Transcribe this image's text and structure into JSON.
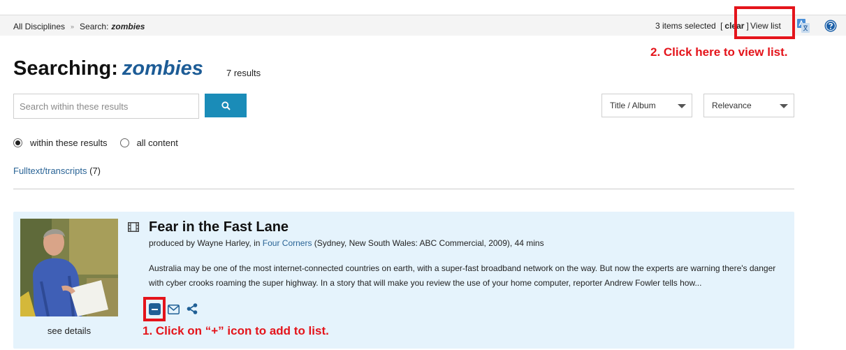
{
  "breadcrumb": {
    "root": "All Disciplines",
    "separator": "»",
    "search_prefix": "Search:",
    "search_term": "zombies"
  },
  "selection": {
    "count_text": "3 items selected",
    "bracket_open": "[",
    "clear_label": "clear",
    "bracket_close": "]",
    "view_list_label": "View list"
  },
  "header_icons": [
    "translate-icon",
    "help-icon"
  ],
  "annotations": {
    "step1": "1. Click on “+” icon to add to list.",
    "step2": "2. Click here to view list.",
    "color": "#e4141b"
  },
  "page": {
    "title_prefix": "Searching:",
    "query": "zombies",
    "result_count": "7 results"
  },
  "search": {
    "placeholder": "Search within these results",
    "value": ""
  },
  "sort": {
    "field_selected": "Title / Album",
    "order_selected": "Relevance"
  },
  "scope": {
    "options": [
      {
        "label": "within these results",
        "selected": true
      },
      {
        "label": "all content",
        "selected": false
      }
    ]
  },
  "facets": {
    "fulltext_label": "Fulltext/transcripts",
    "fulltext_count": "(7)"
  },
  "results": [
    {
      "type_icon": "film-icon",
      "title": "Fear in the Fast Lane",
      "meta_prefix": "produced by Wayne Harley, in",
      "series": "Four Corners",
      "meta_suffix": "(Sydney, New South Wales: ABC Commercial, 2009), 44 mins",
      "description": "Australia may be one of the most internet-connected countries on earth, with a super-fast broadband network on the way. But now the experts are warning there's danger with cyber crooks roaming the super highway. In a story that will make you review the use of your home computer, reporter Andrew Fowler tells how...",
      "see_details_label": "see details",
      "actions": [
        "remove-from-list-icon",
        "email-icon",
        "share-icon"
      ]
    }
  ],
  "colors": {
    "link": "#2a6496",
    "query": "#1d5c96",
    "search_button": "#1a8cb8",
    "card_background": "#e5f3fc",
    "list_button": "#1f5f95"
  }
}
